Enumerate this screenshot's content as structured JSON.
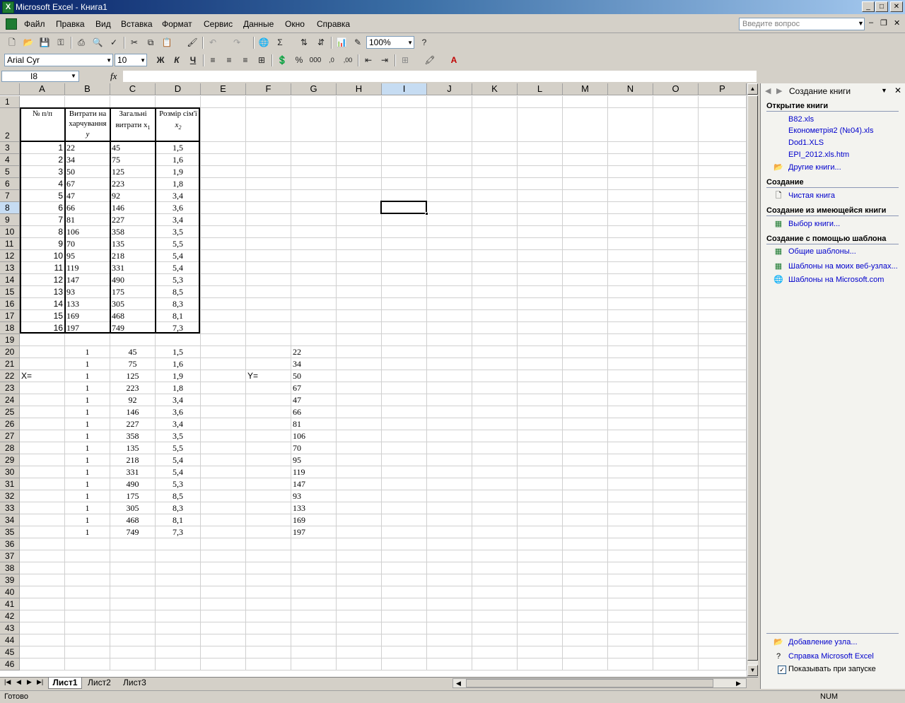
{
  "window": {
    "title": "Microsoft Excel - Книга1",
    "app_icon": "X"
  },
  "menu": {
    "items": [
      "Файл",
      "Правка",
      "Вид",
      "Вставка",
      "Формат",
      "Сервис",
      "Данные",
      "Окно",
      "Справка"
    ],
    "help_placeholder": "Введите вопрос"
  },
  "toolbar": {
    "zoom": "100%",
    "font": "Arial Cyr",
    "size": "10",
    "bold": "Ж",
    "italic": "К",
    "underline": "Ч"
  },
  "formula": {
    "cell_ref": "I8",
    "fx": "fx",
    "content": ""
  },
  "grid": {
    "columns": [
      "A",
      "B",
      "C",
      "D",
      "E",
      "F",
      "G",
      "H",
      "I",
      "J",
      "K",
      "L",
      "M",
      "N",
      "O",
      "P"
    ],
    "header_row": {
      "a": "№ п/п",
      "b1": "Витрати на",
      "b2": "харчування",
      "b3": "y",
      "c1": "Загальні",
      "c2": "витрати x",
      "c2sub": "1",
      "d1": "Розмір сім'ї",
      "d2": "x",
      "d2sub": "2"
    },
    "table1": [
      [
        "1",
        "22",
        "45",
        "1,5"
      ],
      [
        "2",
        "34",
        "75",
        "1,6"
      ],
      [
        "3",
        "50",
        "125",
        "1,9"
      ],
      [
        "4",
        "67",
        "223",
        "1,8"
      ],
      [
        "5",
        "47",
        "92",
        "3,4"
      ],
      [
        "6",
        "66",
        "146",
        "3,6"
      ],
      [
        "7",
        "81",
        "227",
        "3,4"
      ],
      [
        "8",
        "106",
        "358",
        "3,5"
      ],
      [
        "9",
        "70",
        "135",
        "5,5"
      ],
      [
        "10",
        "95",
        "218",
        "5,4"
      ],
      [
        "11",
        "119",
        "331",
        "5,4"
      ],
      [
        "12",
        "147",
        "490",
        "5,3"
      ],
      [
        "13",
        "93",
        "175",
        "8,5"
      ],
      [
        "14",
        "133",
        "305",
        "8,3"
      ],
      [
        "15",
        "169",
        "468",
        "8,1"
      ],
      [
        "16",
        "197",
        "749",
        "7,3"
      ]
    ],
    "x_label": "X=",
    "y_label": "Y=",
    "matrix_x": [
      [
        "1",
        "45",
        "1,5"
      ],
      [
        "1",
        "75",
        "1,6"
      ],
      [
        "1",
        "125",
        "1,9"
      ],
      [
        "1",
        "223",
        "1,8"
      ],
      [
        "1",
        "92",
        "3,4"
      ],
      [
        "1",
        "146",
        "3,6"
      ],
      [
        "1",
        "227",
        "3,4"
      ],
      [
        "1",
        "358",
        "3,5"
      ],
      [
        "1",
        "135",
        "5,5"
      ],
      [
        "1",
        "218",
        "5,4"
      ],
      [
        "1",
        "331",
        "5,4"
      ],
      [
        "1",
        "490",
        "5,3"
      ],
      [
        "1",
        "175",
        "8,5"
      ],
      [
        "1",
        "305",
        "8,3"
      ],
      [
        "1",
        "468",
        "8,1"
      ],
      [
        "1",
        "749",
        "7,3"
      ]
    ],
    "matrix_y": [
      "22",
      "34",
      "50",
      "67",
      "47",
      "66",
      "81",
      "106",
      "70",
      "95",
      "119",
      "147",
      "93",
      "133",
      "169",
      "197"
    ]
  },
  "sheets": [
    "Лист1",
    "Лист2",
    "Лист3"
  ],
  "status": {
    "left": "Готово",
    "num": "NUM"
  },
  "task_pane": {
    "title": "Создание книги",
    "open_section": "Открытие книги",
    "recent": [
      "B82.xls",
      "Економетрія2 (№04).xls",
      "Dod1.XLS",
      "EPI_2012.xls.htm"
    ],
    "more_books": "Другие книги...",
    "new_section": "Создание",
    "blank_book": "Чистая книга",
    "existing_section": "Создание из имеющейся книги",
    "choose_book": "Выбор книги...",
    "template_section": "Создание с помощью шаблона",
    "templates": [
      "Общие шаблоны...",
      "Шаблоны на моих веб-узлах...",
      "Шаблоны на Microsoft.com"
    ],
    "add_place": "Добавление узла...",
    "excel_help": "Справка Microsoft Excel",
    "show_on_startup": "Показывать при запуске"
  }
}
